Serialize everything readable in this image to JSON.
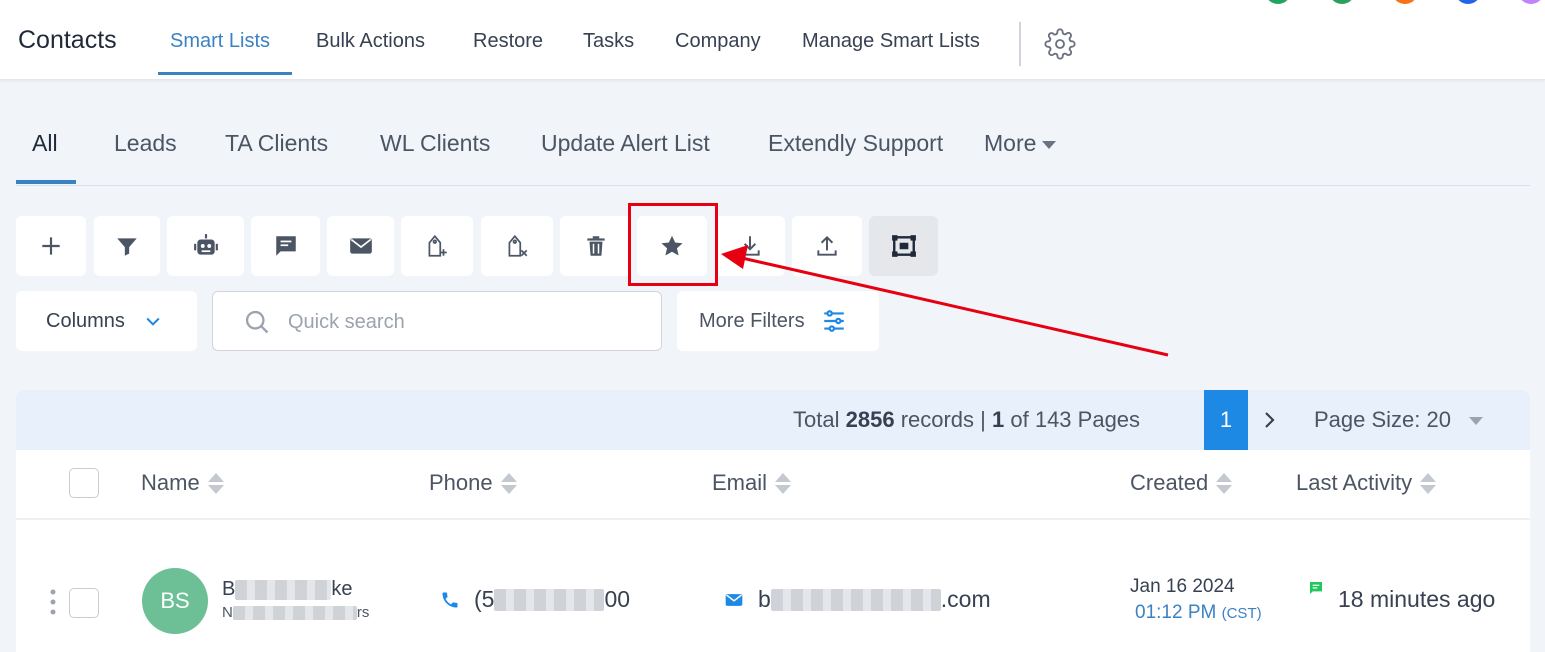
{
  "app": {
    "title": "Contacts"
  },
  "top_nav": {
    "tabs": [
      {
        "label": "Smart Lists",
        "active": true
      },
      {
        "label": "Bulk Actions"
      },
      {
        "label": "Restore"
      },
      {
        "label": "Tasks"
      },
      {
        "label": "Company"
      },
      {
        "label": "Manage Smart Lists"
      }
    ],
    "settings_icon": "gear-icon",
    "user_dots_colors": [
      "#22a45d",
      "#2e9e5b",
      "#f97316",
      "#2563eb",
      "#c084fc"
    ]
  },
  "sub_tabs": {
    "items": [
      {
        "label": "All",
        "active": true
      },
      {
        "label": "Leads"
      },
      {
        "label": "TA Clients"
      },
      {
        "label": "WL Clients"
      },
      {
        "label": "Update Alert List"
      },
      {
        "label": "Extendly Support"
      }
    ],
    "more_label": "More"
  },
  "toolbar": {
    "buttons": [
      {
        "icon": "plus-icon"
      },
      {
        "icon": "filter-icon"
      },
      {
        "icon": "robot-icon"
      },
      {
        "icon": "message-icon"
      },
      {
        "icon": "mail-icon"
      },
      {
        "icon": "add-tag-icon"
      },
      {
        "icon": "remove-tag-icon"
      },
      {
        "icon": "trash-icon"
      },
      {
        "icon": "star-icon",
        "highlighted": true
      },
      {
        "icon": "download-icon"
      },
      {
        "icon": "upload-icon"
      },
      {
        "icon": "merge-icon"
      }
    ]
  },
  "filters": {
    "columns_label": "Columns",
    "search_placeholder": "Quick search",
    "more_filters_label": "More Filters"
  },
  "pagination": {
    "total_prefix": "Total",
    "total_records": "2856",
    "records_word": "records |",
    "current_page": "1",
    "of_pages_text": "of 143 Pages",
    "page_button": "1",
    "page_size_label": "Page Size: 20"
  },
  "table": {
    "columns": [
      "Name",
      "Phone",
      "Email",
      "Created",
      "Last Activity"
    ],
    "rows": [
      {
        "avatar_initials": "BS",
        "name_start": "B",
        "name_end": "ke",
        "company_start": "N",
        "company_end": "rs",
        "phone_start": "(5",
        "phone_end": "00",
        "email_start": "b",
        "email_end": ".com",
        "created_date": "Jan 16 2024",
        "created_time": "01:12 PM",
        "created_tz": "(CST)",
        "last_activity": "18 minutes ago"
      }
    ]
  },
  "colors": {
    "accent": "#3b82c4",
    "page_active": "#1e88e5",
    "highlight": "#e60012",
    "avatar": "#6dbf96"
  }
}
